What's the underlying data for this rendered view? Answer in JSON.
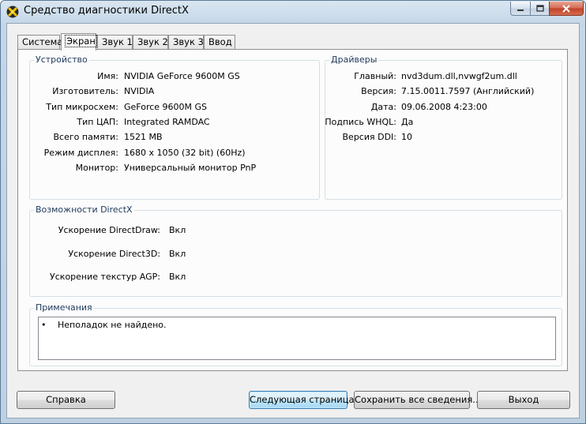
{
  "window": {
    "title": "Средство диагностики DirectX"
  },
  "tabs": [
    {
      "label": "Система"
    },
    {
      "label": "Экран"
    },
    {
      "label": "Звук 1"
    },
    {
      "label": "Звук 2"
    },
    {
      "label": "Звук 3"
    },
    {
      "label": "Ввод"
    }
  ],
  "device": {
    "group_label": "Устройство",
    "rows": [
      {
        "label": "Имя:",
        "value": "NVIDIA GeForce 9600M GS"
      },
      {
        "label": "Изготовитель:",
        "value": "NVIDIA"
      },
      {
        "label": "Тип микросхем:",
        "value": "GeForce 9600M GS"
      },
      {
        "label": "Тип ЦАП:",
        "value": "Integrated RAMDAC"
      },
      {
        "label": "Всего памяти:",
        "value": "1521 MB"
      },
      {
        "label": "Режим дисплея:",
        "value": "1680 x 1050 (32 bit) (60Hz)"
      },
      {
        "label": "Монитор:",
        "value": "Универсальный монитор PnP"
      }
    ]
  },
  "drivers": {
    "group_label": "Драйверы",
    "rows": [
      {
        "label": "Главный:",
        "value": "nvd3dum.dll,nvwgf2um.dll"
      },
      {
        "label": "Версия:",
        "value": "7.15.0011.7597 (Английский)"
      },
      {
        "label": "Дата:",
        "value": "09.06.2008 4:23:00"
      },
      {
        "label": "Подпись WHQL:",
        "value": "Да"
      },
      {
        "label": "Версия DDI:",
        "value": "10"
      }
    ]
  },
  "features": {
    "group_label": "Возможности DirectX",
    "rows": [
      {
        "label": "Ускорение DirectDraw:",
        "value": "Вкл"
      },
      {
        "label": "Ускорение Direct3D:",
        "value": "Вкл"
      },
      {
        "label": "Ускорение текстур AGP:",
        "value": "Вкл"
      }
    ]
  },
  "notes": {
    "group_label": "Примечания",
    "bullet": "•",
    "text": "Неполадок не найдено."
  },
  "buttons": {
    "help": "Справка",
    "next": "Следующая страница",
    "save": "Сохранить все сведения...",
    "exit": "Выход"
  },
  "colors": {
    "close_button": "#c0402a",
    "default_button_border": "#3c7fb1"
  }
}
